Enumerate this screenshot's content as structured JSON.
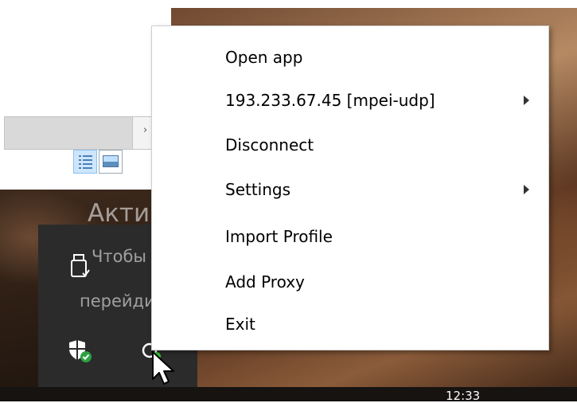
{
  "context_menu": {
    "items": [
      {
        "label": "Open app",
        "has_submenu": false
      },
      {
        "label": "193.233.67.45 [mpei-udp]",
        "has_submenu": true
      },
      {
        "label": "Disconnect",
        "has_submenu": false
      },
      {
        "label": "Settings",
        "has_submenu": true
      },
      {
        "label": "Import Profile",
        "has_submenu": false
      },
      {
        "label": "Add Proxy",
        "has_submenu": false
      },
      {
        "label": "Exit",
        "has_submenu": false
      }
    ]
  },
  "watermark": {
    "title": "Активация Windows",
    "line1": "Чтобы активировать Windows,",
    "line2": "перейдите в раздел \"Параметры\""
  },
  "explorer": {
    "address_chevron": "›"
  },
  "tray": {
    "icons": [
      "usb-eject-icon",
      "windows-security-icon",
      "vpn-status-icon"
    ],
    "vpn_status_color": "#3cc13c",
    "security_badge_color": "#2ea043"
  },
  "taskbar": {
    "clock_partial": "12:33"
  },
  "colors": {
    "menu_background": "#ffffff",
    "tray_flyout_background": "#2b2b2b"
  }
}
